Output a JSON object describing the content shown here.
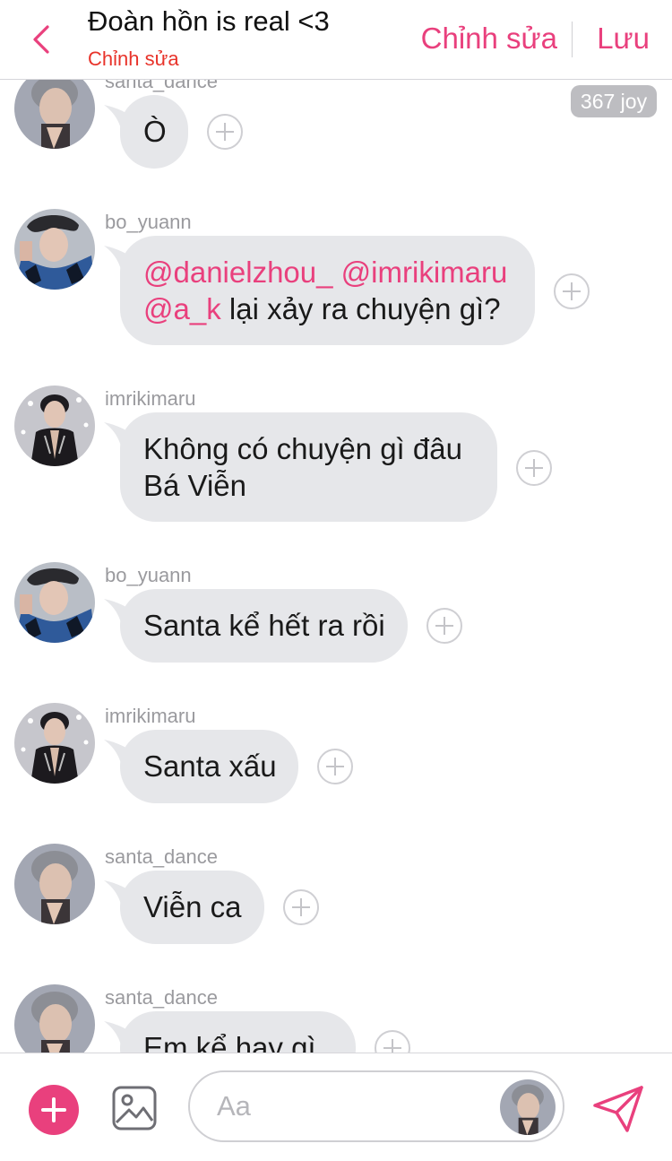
{
  "header": {
    "title": "Đoàn hồn is real <3",
    "subtitle": "Chỉnh sửa",
    "edit_label": "Chỉnh sửa",
    "save_label": "Lưu"
  },
  "messages": [
    {
      "username": "santa_dance",
      "text": "Ò",
      "avatar": "santa"
    },
    {
      "username": "bo_yuann",
      "mentions": [
        "@danielzhou_",
        "@imrikimaru",
        "@a_k"
      ],
      "text": "lại xảy ra chuyện gì?",
      "avatar": "bo"
    },
    {
      "username": "imrikimaru",
      "line1": "Không có chuyện gì đâu",
      "line2": "Bá Viễn",
      "avatar": "imri"
    },
    {
      "username": "bo_yuann",
      "text": "Santa kể hết ra rồi",
      "avatar": "bo"
    },
    {
      "username": "imrikimaru",
      "text": "Santa xấu",
      "avatar": "imri"
    },
    {
      "username": "santa_dance",
      "text": "Viễn ca",
      "avatar": "santa"
    },
    {
      "username": "santa_dance",
      "text": "Em kể hay gì",
      "avatar": "santa"
    }
  ],
  "joy_badge": "367 joy",
  "input": {
    "placeholder": "Aa"
  },
  "colors": {
    "accent": "#e9407d",
    "subtitle": "#e8332a",
    "bubble": "#e6e7ea",
    "username": "#9a9a9e"
  },
  "icons": [
    "back-chevron-icon",
    "plus-icon",
    "image-icon",
    "send-icon",
    "add-reaction-icon"
  ]
}
